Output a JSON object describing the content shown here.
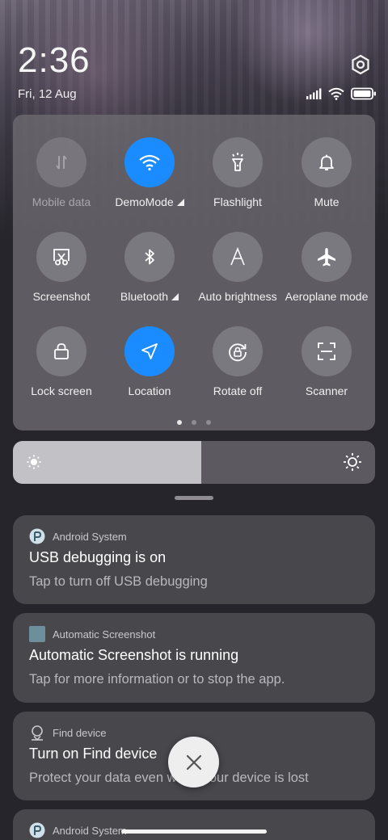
{
  "status": {
    "time": "2:36",
    "date": "Fri, 12 Aug",
    "icons": [
      "settings-icon",
      "signal-icon",
      "wifi-icon",
      "battery-icon"
    ]
  },
  "quick_settings": {
    "tiles": [
      {
        "label": "Mobile data",
        "icon": "mobile-data-icon",
        "state": "disabled"
      },
      {
        "label": "DemoMode",
        "icon": "wifi-icon",
        "state": "active",
        "has_menu": true
      },
      {
        "label": "Flashlight",
        "icon": "flashlight-icon",
        "state": "off"
      },
      {
        "label": "Mute",
        "icon": "bell-icon",
        "state": "off"
      },
      {
        "label": "Screenshot",
        "icon": "screenshot-icon",
        "state": "off"
      },
      {
        "label": "Bluetooth",
        "icon": "bluetooth-icon",
        "state": "off",
        "has_menu": true
      },
      {
        "label": "Auto brightness",
        "icon": "auto-brightness-icon",
        "state": "off"
      },
      {
        "label": "Aeroplane mode",
        "icon": "airplane-icon",
        "state": "off"
      },
      {
        "label": "Lock screen",
        "icon": "lock-icon",
        "state": "off"
      },
      {
        "label": "Location",
        "icon": "location-icon",
        "state": "active"
      },
      {
        "label": "Rotate off",
        "icon": "rotate-lock-icon",
        "state": "off"
      },
      {
        "label": "Scanner",
        "icon": "scanner-icon",
        "state": "off"
      }
    ],
    "page_count": 3,
    "current_page": 1,
    "active_color": "#1a8cff"
  },
  "brightness": {
    "level": 0.52,
    "icons": [
      "brightness-low-icon",
      "brightness-high-icon"
    ]
  },
  "notifications": [
    {
      "app": "Android System",
      "title": "USB debugging is on",
      "body": "Tap to turn off USB debugging",
      "icon": "android-system-icon"
    },
    {
      "app": "Automatic Screenshot",
      "title": "Automatic Screenshot is running",
      "body": "Tap for more information or to stop the app.",
      "icon": "app-square-icon"
    },
    {
      "app": "Find device",
      "title": "Turn on Find device",
      "body": "Protect your data even when your device is lost",
      "icon": "find-device-icon"
    },
    {
      "app": "Android System",
      "title": "",
      "body": "",
      "icon": "android-system-icon"
    }
  ],
  "close_button": {
    "icon": "close-icon"
  }
}
